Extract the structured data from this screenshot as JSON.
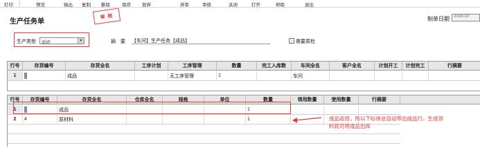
{
  "toolbar": {
    "items": [
      "打印",
      "预览",
      "输出",
      "复制",
      "删除",
      "保存",
      "放弃",
      "弃审",
      "审核",
      "关闭",
      "打开",
      "帮助",
      "退出"
    ]
  },
  "header": {
    "title": "生产任务单",
    "stamp": "审 核",
    "mfg_date_label": "制单日期",
    "mfg_date_value": "2019-10",
    "prod_type_label": "生产类型",
    "prod_type_value": "返修",
    "desc_label": "摘　要",
    "desc_value": "【车间】生产任务【成品】",
    "urgent_label": "需要质检"
  },
  "grid1": {
    "headers": [
      "行号",
      "存货编号",
      "存货全名",
      "工序计划",
      "工序管理",
      "数量",
      "完工入库数",
      "车间全名",
      "客户全名",
      "计划开工",
      "计划完工",
      "行摘要"
    ],
    "rows": [
      {
        "num": "1",
        "code": "",
        "name": "成品",
        "process_plan": "",
        "process_mgmt": "无工序管理",
        "qty": "1",
        "done": "",
        "workshop": "车间"
      }
    ]
  },
  "grid2": {
    "headers": [
      "行号",
      "存货编号",
      "存货全名",
      "仓库全名",
      "规格",
      "单位",
      "数量",
      "领用数量",
      "使用数量",
      "行摘要"
    ],
    "rows": [
      {
        "num": "1",
        "code": "",
        "name": "成品",
        "qty": "1"
      },
      {
        "num": "2",
        "code": "4",
        "name": "原材料",
        "qty": "1"
      }
    ]
  },
  "annotation": {
    "text_line1": "成品返修，所以下标体会自动带出成品行，生成领",
    "text_line2": "料就可将成品出库"
  },
  "colors": {
    "red_highlight": "#e53935",
    "header_bg": "#e6e6e6"
  }
}
